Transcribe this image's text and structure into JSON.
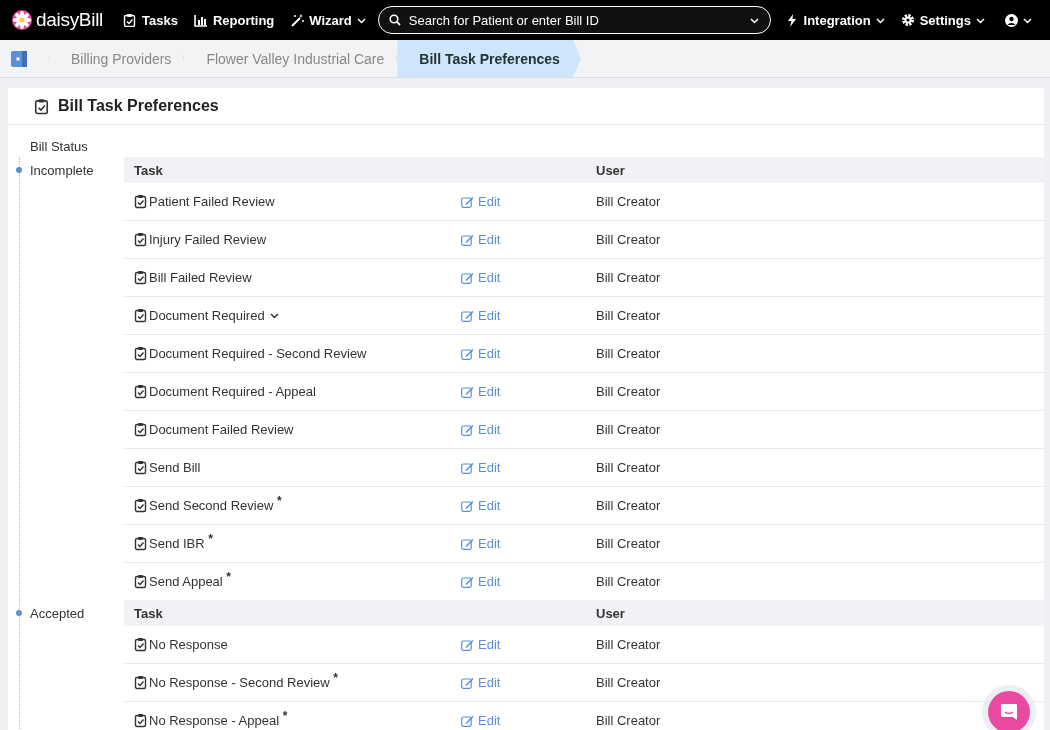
{
  "navbar": {
    "logo": "daisyBill",
    "items": [
      {
        "label": "Tasks",
        "dropdown": false
      },
      {
        "label": "Reporting",
        "dropdown": false
      },
      {
        "label": "Wizard",
        "dropdown": true
      }
    ],
    "search": {
      "placeholder": "Search for Patient or enter Bill ID"
    },
    "right_items": [
      {
        "label": "Integration"
      },
      {
        "label": "Settings"
      }
    ]
  },
  "breadcrumbs": [
    {
      "label": "Billing Providers",
      "selected": false
    },
    {
      "label": "Flower Valley Industrial Care",
      "selected": false
    },
    {
      "label": "Bill Task Preferences",
      "selected": true
    }
  ],
  "page": {
    "title": "Bill Task Preferences",
    "status_heading": "Bill Status"
  },
  "groups": [
    {
      "status": "Incomplete",
      "columns": [
        "Task",
        "User"
      ],
      "rows": [
        {
          "task": "Patient Failed Review",
          "has_caret": false,
          "action": "Edit",
          "user": "Bill Creator"
        },
        {
          "task": "Injury Failed Review",
          "has_caret": false,
          "action": "Edit",
          "user": "Bill Creator"
        },
        {
          "task": "Bill Failed Review",
          "has_caret": false,
          "action": "Edit",
          "user": "Bill Creator"
        },
        {
          "task": "Document Required",
          "has_caret": true,
          "action": "Edit",
          "user": "Bill Creator"
        },
        {
          "task": "Document Required - Second Review",
          "has_caret": false,
          "action": "Edit",
          "user": "Bill Creator"
        },
        {
          "task": "Document Required - Appeal",
          "has_caret": false,
          "action": "Edit",
          "user": "Bill Creator"
        },
        {
          "task": "Document Failed Review",
          "has_caret": false,
          "action": "Edit",
          "user": "Bill Creator"
        },
        {
          "task": "Send Bill",
          "has_caret": false,
          "action": "Edit",
          "user": "Bill Creator"
        },
        {
          "task": "Send Second Review $^{*}$",
          "has_caret": false,
          "action": "Edit",
          "user": "Bill Creator"
        },
        {
          "task": "Send IBR $^{*}$",
          "has_caret": false,
          "action": "Edit",
          "user": "Bill Creator"
        },
        {
          "task": "Send Appeal $^{*}$",
          "has_caret": false,
          "action": "Edit",
          "user": "Bill Creator"
        }
      ]
    },
    {
      "status": "Accepted",
      "columns": [
        "Task",
        "User"
      ],
      "rows": [
        {
          "task": "No Response",
          "has_caret": false,
          "action": "Edit",
          "user": "Bill Creator"
        },
        {
          "task": "No Response - Second Review $^{*}$",
          "has_caret": false,
          "action": "Edit",
          "user": "Bill Creator"
        },
        {
          "task": "No Response - Appeal $^{*}$",
          "has_caret": false,
          "action": "Edit",
          "user": "Bill Creator"
        }
      ]
    }
  ]
}
